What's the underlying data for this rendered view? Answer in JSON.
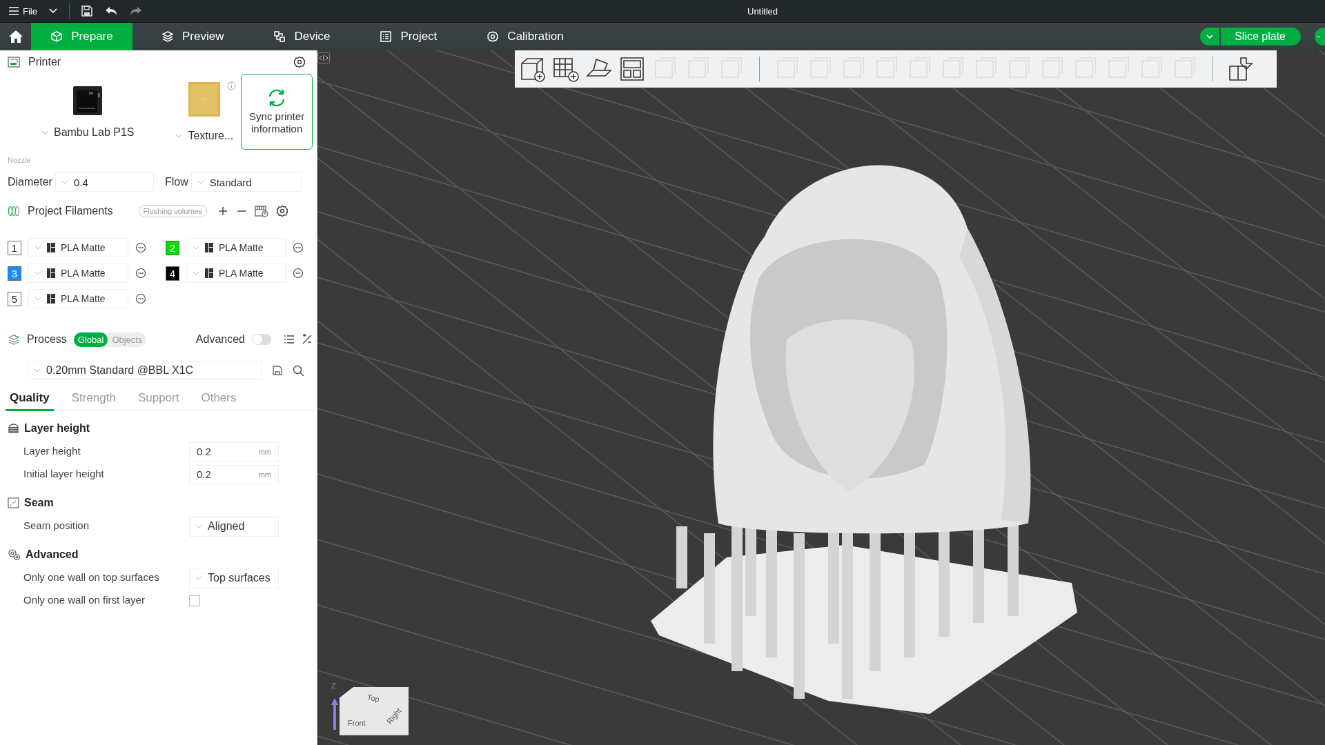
{
  "title_bar": {
    "menu_label": "File",
    "title": "Untitled"
  },
  "nav_tabs": [
    {
      "label": "Prepare",
      "kind": "cube",
      "selected": true
    },
    {
      "label": "Preview",
      "kind": "layers",
      "selected": false
    },
    {
      "label": "Device",
      "kind": "device",
      "selected": false
    },
    {
      "label": "Project",
      "kind": "list",
      "selected": false
    },
    {
      "label": "Calibration",
      "kind": "gear",
      "selected": false
    }
  ],
  "slice_button": {
    "label": "Slice plate"
  },
  "printer": {
    "title": "Printer",
    "printer_name": "Bambu Lab P1S",
    "plate_name": "Texture...",
    "sync_label": "Sync printer information",
    "nozzle_label": "Nozzle",
    "diameter_label": "Diameter",
    "diameter_value": "0.4",
    "flow_label": "Flow",
    "flow_value": "Standard"
  },
  "filaments": {
    "title": "Project Filaments",
    "flush_button": "Flushing volumes",
    "items": [
      {
        "number": "1",
        "name": "PLA Matte",
        "color": "#ffffff"
      },
      {
        "number": "2",
        "name": "PLA Matte",
        "color": "#00dd00"
      },
      {
        "number": "3",
        "name": "PLA Matte",
        "color": "#1a8cff"
      },
      {
        "number": "4",
        "name": "PLA Matte",
        "color": "#000000"
      },
      {
        "number": "5",
        "name": "PLA Matte",
        "color": "#ffffff"
      }
    ]
  },
  "process": {
    "title": "Process",
    "scope": [
      {
        "label": "Global",
        "selected": true
      },
      {
        "label": "Objects",
        "selected": false
      }
    ],
    "advanced_label": "Advanced",
    "advanced_on": false,
    "preset": "0.20mm Standard @BBL X1C",
    "tabs": [
      {
        "label": "Quality",
        "selected": true
      },
      {
        "label": "Strength",
        "selected": false
      },
      {
        "label": "Support",
        "selected": false
      },
      {
        "label": "Others",
        "selected": false
      }
    ],
    "sections": [
      {
        "title": "Layer height",
        "kind": "layers",
        "settings": [
          {
            "label": "Layer height",
            "kind": "number",
            "value": "0.2",
            "unit": "mm"
          },
          {
            "label": "Initial layer height",
            "kind": "number",
            "value": "0.2",
            "unit": "mm"
          }
        ]
      },
      {
        "title": "Seam",
        "kind": "seam",
        "settings": [
          {
            "label": "Seam position",
            "kind": "select",
            "value": "Aligned"
          }
        ]
      },
      {
        "title": "Advanced",
        "kind": "gears",
        "settings": [
          {
            "label": "Only one wall on top surfaces",
            "kind": "select",
            "value": "Top surfaces"
          },
          {
            "label": "Only one wall on first layer",
            "kind": "checkbox",
            "checked": false
          }
        ]
      }
    ]
  },
  "toolbar": {
    "tools": [
      {
        "kind": "cube",
        "disabled": false
      },
      {
        "kind": "grid",
        "disabled": false
      },
      {
        "kind": "orient",
        "disabled": false
      },
      {
        "kind": "arrange",
        "disabled": false
      },
      {
        "kind": "generic",
        "disabled": true
      },
      {
        "kind": "generic",
        "disabled": true
      },
      {
        "kind": "generic",
        "disabled": true
      },
      {
        "kind": "separator"
      },
      {
        "kind": "generic",
        "disabled": true
      },
      {
        "kind": "generic",
        "disabled": true
      },
      {
        "kind": "generic",
        "disabled": true
      },
      {
        "kind": "generic",
        "disabled": true
      },
      {
        "kind": "generic",
        "disabled": true
      },
      {
        "kind": "generic",
        "disabled": true
      },
      {
        "kind": "generic",
        "disabled": true
      },
      {
        "kind": "generic",
        "disabled": true
      },
      {
        "kind": "generic",
        "disabled": true
      },
      {
        "kind": "generic",
        "disabled": true
      },
      {
        "kind": "generic",
        "disabled": true
      },
      {
        "kind": "generic",
        "disabled": true
      },
      {
        "kind": "generic",
        "disabled": true
      },
      {
        "kind": "separator"
      },
      {
        "kind": "parts",
        "disabled": false
      }
    ]
  },
  "view_cube": {
    "axis_label": "Z",
    "top": "Top",
    "front": "Front",
    "right": "Right"
  }
}
